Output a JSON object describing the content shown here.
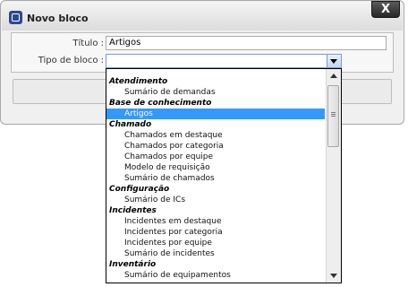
{
  "dialog": {
    "title": "Novo bloco",
    "close_label": "X"
  },
  "form": {
    "titulo_label": "Título :",
    "titulo_value": "Artigos",
    "tipo_label": "Tipo de bloco :",
    "tipo_value": ""
  },
  "dropdown": {
    "groups": [
      {
        "label": "Atendimento",
        "options": [
          "Sumário de demandas"
        ]
      },
      {
        "label": "Base de conhecimento",
        "options": [
          "Artigos"
        ]
      },
      {
        "label": "Chamado",
        "options": [
          "Chamados em destaque",
          "Chamados por categoria",
          "Chamados por equipe",
          "Modelo de requisição",
          "Sumário de chamados"
        ]
      },
      {
        "label": "Configuração",
        "options": [
          "Sumário de ICs"
        ]
      },
      {
        "label": "Incidentes",
        "options": [
          "Incidentes em destaque",
          "Incidentes por categoria",
          "Incidentes por equipe",
          "Sumário de incidentes"
        ]
      },
      {
        "label": "Inventário",
        "options": [
          "Sumário de equipamentos"
        ]
      }
    ],
    "selected": "Artigos"
  },
  "icons": {
    "app": "window-icon",
    "close": "close-icon",
    "select_arrow": "chevron-down-icon"
  },
  "colors": {
    "selection": "#3399ff",
    "close_button": "#333333"
  }
}
